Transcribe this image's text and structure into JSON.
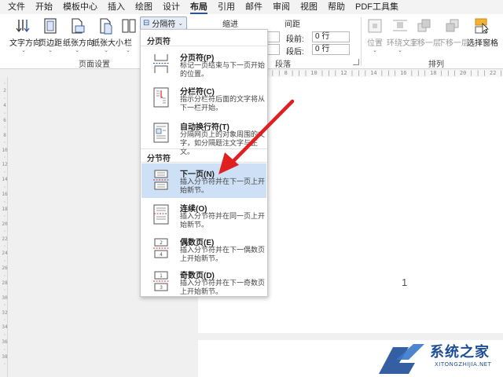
{
  "menubar": {
    "items": [
      "文件",
      "开始",
      "模板中心",
      "插入",
      "绘图",
      "设计",
      "布局",
      "引用",
      "邮件",
      "审阅",
      "视图",
      "帮助",
      "PDF工具集"
    ],
    "active_index": 6
  },
  "ribbon": {
    "page_setup": {
      "buttons": [
        "文字方向",
        "页边距",
        "纸张方向",
        "纸张大小",
        "栏"
      ],
      "group_label": "页面设置"
    },
    "breaks_button": "分隔符",
    "indent_label": "缩进",
    "spacing_label": "间距",
    "spacing_before_label": "段前:",
    "spacing_before_value": "0 行",
    "spacing_after_label": "段后:",
    "spacing_after_value": "0 行",
    "paragraph_group_label": "段落",
    "arrange": {
      "buttons": [
        "位置",
        "环绕文字",
        "上移一层",
        "下移一层",
        "选择窗格"
      ],
      "group_label": "排列"
    }
  },
  "dropdown": {
    "page_breaks_header": "分页符",
    "section_breaks_header": "分节符",
    "items": [
      {
        "title": "分页符(P)",
        "desc": "标记一页结束与下一页开始的位置。",
        "icon": "page-break-icon"
      },
      {
        "title": "分栏符(C)",
        "desc": "指示分栏符后面的文字将从下一栏开始。",
        "icon": "column-break-icon"
      },
      {
        "title": "自动换行符(T)",
        "desc": "分隔网页上的对象周围的文字，如分隔题注文字与正文。",
        "icon": "text-wrapping-icon"
      },
      {
        "title": "下一页(N)",
        "desc": "插入分节符并在下一页上开始新节。",
        "icon": "next-page-icon"
      },
      {
        "title": "连续(O)",
        "desc": "插入分节符并在同一页上开始新节。",
        "icon": "continuous-icon"
      },
      {
        "title": "偶数页(E)",
        "desc": "插入分节符并在下一偶数页上开始新节。",
        "icon": "even-page-icon"
      },
      {
        "title": "奇数页(D)",
        "desc": "插入分节符并在下一奇数页上开始新节。",
        "icon": "odd-page-icon"
      }
    ],
    "highlighted_index": 3
  },
  "document": {
    "page_number": "1"
  },
  "watermark": {
    "title": "系统之家",
    "subtitle": "XITONGZHIJIA.NET"
  },
  "colors": {
    "accent": "#2b579a",
    "arrow": "#e02020",
    "highlight": "#cde0f5"
  }
}
